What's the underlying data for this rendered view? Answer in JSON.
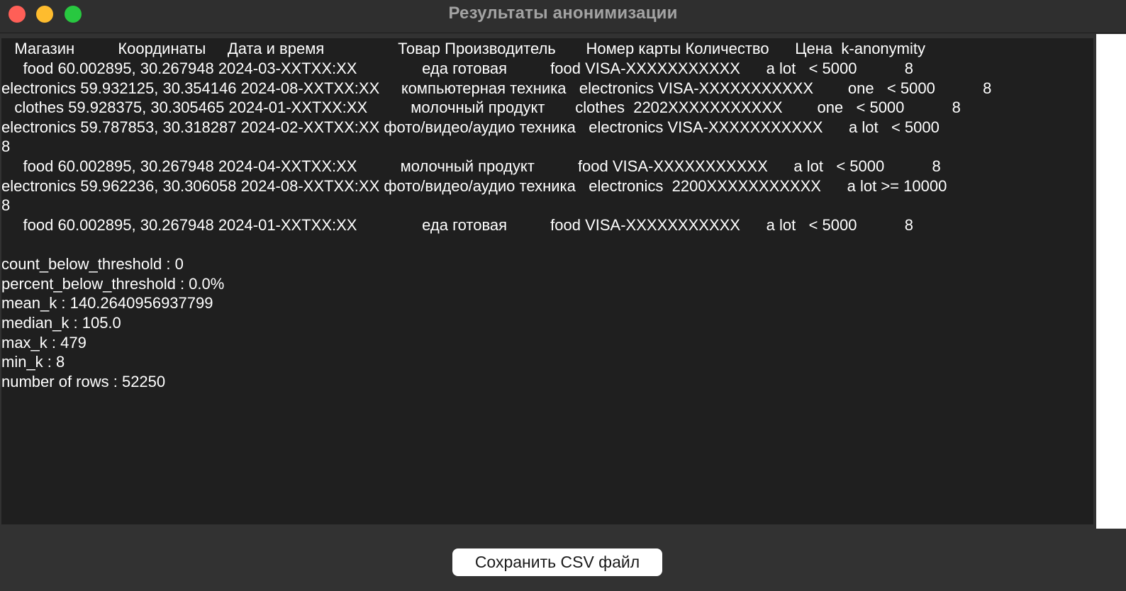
{
  "window": {
    "title": "Результаты анонимизации"
  },
  "output": {
    "lines": [
      "   Магазин          Координаты     Дата и время                 Товар Производитель       Номер карты Количество      Цена  k-anonymity",
      "     food 60.002895, 30.267948 2024-03-XXTXX:XX               еда готовая          food VISA-XXXXXXXXXXX      a lot   < 5000           8",
      "electronics 59.932125, 30.354146 2024-08-XXTXX:XX     компьютерная техника   electronics VISA-XXXXXXXXXXX        one   < 5000           8",
      "   clothes 59.928375, 30.305465 2024-01-XXTXX:XX          молочный продукт       clothes  2202XXXXXXXXXXX        one   < 5000           8",
      "electronics 59.787853, 30.318287 2024-02-XXTXX:XX фото/видео/аудио техника   electronics VISA-XXXXXXXXXXX      a lot   < 5000",
      "8",
      "     food 60.002895, 30.267948 2024-04-XXTXX:XX          молочный продукт          food VISA-XXXXXXXXXXX      a lot   < 5000           8",
      "electronics 59.962236, 30.306058 2024-08-XXTXX:XX фото/видео/аудио техника   electronics  2200XXXXXXXXXXX      a lot >= 10000",
      "8",
      "     food 60.002895, 30.267948 2024-01-XXTXX:XX               еда готовая          food VISA-XXXXXXXXXXX      a lot   < 5000           8",
      "",
      "count_below_threshold : 0",
      "percent_below_threshold : 0.0%",
      "mean_k : 140.2640956937799",
      "median_k : 105.0",
      "max_k : 479",
      "min_k : 8",
      "number of rows : 52250"
    ]
  },
  "buttons": {
    "save_csv": "Сохранить CSV файл"
  },
  "colors": {
    "close": "#ff5f57",
    "minimize": "#febc2e",
    "maximize": "#28c840",
    "text_area_bg": "#1f1f1f",
    "window_bg": "#323232"
  }
}
